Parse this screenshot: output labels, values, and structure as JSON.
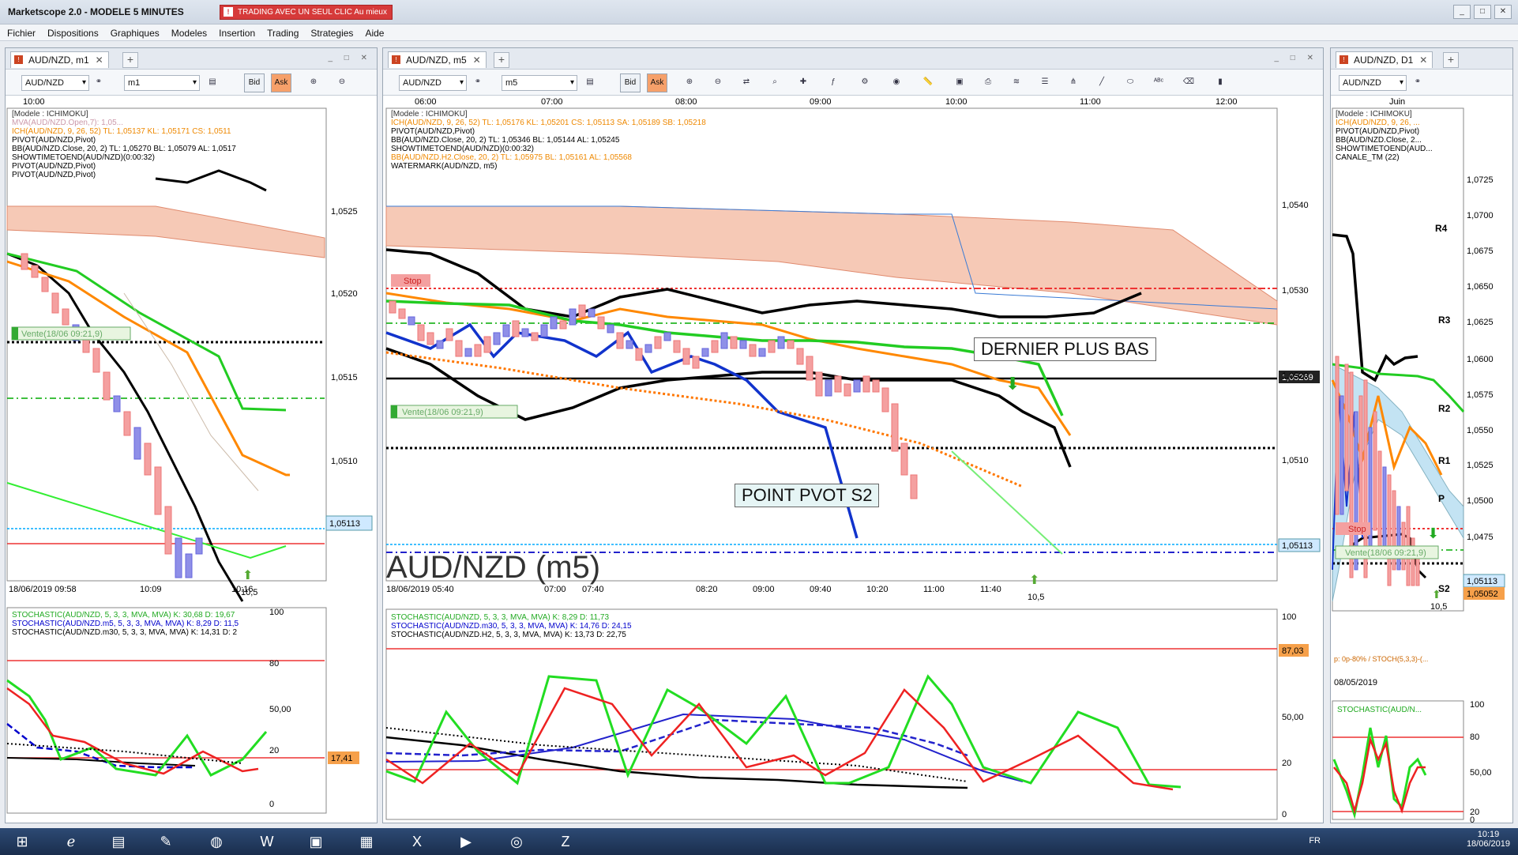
{
  "window": {
    "title": "Marketscope 2.0 - MODELE 5 MINUTES",
    "promo": "TRADING AVEC UN SEUL CLIC Au mieux"
  },
  "menu": [
    "Fichier",
    "Dispositions",
    "Graphiques",
    "Modeles",
    "Insertion",
    "Trading",
    "Strategies",
    "Aide"
  ],
  "left": {
    "tab": "AUD/NZD, m1",
    "instrument": "AUD/NZD",
    "period": "m1",
    "time_top": "10:00",
    "indicators": [
      "[Modele : ICHIMOKU]",
      "MVA(AUD/NZD.Open,7): 1,05...",
      "ICH(AUD/NZD, 9, 26, 52) TL: 1,05137 KL: 1,05171 CS: 1,0511",
      "PIVOT(AUD/NZD,Pivot)",
      "BB(AUD/NZD.Close, 20, 2) TL: 1,05270 BL: 1,05079 AL: 1,0517",
      "SHOWTIMETOEND(AUD/NZD)(0:00:32)",
      "PIVOT(AUD/NZD,Pivot)",
      "PIVOT(AUD/NZD,Pivot)"
    ],
    "y_ticks": [
      "1,0525",
      "1,0520",
      "1,0515",
      "1,0510"
    ],
    "price_tag": "1,05113",
    "order_label": "Vente(18/06 09:21,9)",
    "arrow_label": "10,5",
    "x_ticks": [
      "18/06/2019 09:58",
      "10:09",
      "10:16"
    ],
    "stoch_lines": [
      "STOCHASTIC(AUD/NZD, 5, 3, 3, MVA, MVA) K: 30,68 D: 19,67",
      "STOCHASTIC(AUD/NZD.m5, 5, 3, 3, MVA, MVA) K: 8,29 D: 11,5",
      "STOCHASTIC(AUD/NZD.m30, 5, 3, 3, MVA, MVA) K: 14,31 D: 2"
    ],
    "stoch_ticks": [
      "100",
      "80",
      "50,00",
      "20",
      "0"
    ],
    "stoch_tag": "17,41"
  },
  "center": {
    "tab": "AUD/NZD, m5",
    "instrument": "AUD/NZD",
    "period": "m5",
    "time_top": [
      "06:00",
      "07:00",
      "08:00",
      "09:00",
      "10:00",
      "11:00",
      "12:00"
    ],
    "indicators": [
      "[Modele : ICHIMOKU]",
      "ICH(AUD/NZD, 9, 26, 52) TL: 1,05176 KL: 1,05201 CS: 1,05113 SA: 1,05189 SB: 1,05218",
      "PIVOT(AUD/NZD,Pivot)",
      "BB(AUD/NZD.Close, 20, 2) TL: 1,05346 BL: 1,05144 AL: 1,05245",
      "SHOWTIMETOEND(AUD/NZD)(0:00:32)",
      "BB(AUD/NZD.H2.Close, 20, 2) TL: 1,05975 BL: 1,05161 AL: 1,05568",
      "WATERMARK(AUD/NZD, m5)"
    ],
    "y_ticks": [
      "1,0540",
      "1,0530",
      "1,0520",
      "1,0510"
    ],
    "price_tags": [
      "1,05269",
      "1,05113"
    ],
    "stop_label": "Stop",
    "order_label": "Vente(18/06 09:21,9)",
    "annot1": "DERNIER PLUS BAS",
    "annot2": "POINT PVOT S2",
    "watermark": "AUD/NZD (m5)",
    "arrow_label": "10,5",
    "x_ticks": [
      "18/06/2019 05:40",
      "07:00",
      "07:40",
      "08:20",
      "09:00",
      "09:40",
      "10:20",
      "11:00",
      "11:40"
    ],
    "stoch_lines": [
      "STOCHASTIC(AUD/NZD, 5, 3, 3, MVA, MVA) K: 8,29 D: 11,73",
      "STOCHASTIC(AUD/NZD.m30, 5, 3, 3, MVA, MVA) K: 14,76 D: 24,15",
      "STOCHASTIC(AUD/NZD.H2, 5, 3, 3, MVA, MVA) K: 13,73 D: 22,75"
    ],
    "stoch_ticks": [
      "100",
      "80",
      "50,00",
      "20",
      "0"
    ],
    "stoch_tag": "87,03"
  },
  "right": {
    "tab": "AUD/NZD, D1",
    "instrument": "AUD/NZD",
    "time_top": "Juin",
    "indicators": [
      "[Modele : ICHIMOKU]",
      "ICH(AUD/NZD, 9, 26, ...",
      "PIVOT(AUD/NZD,Pivot)",
      "BB(AUD/NZD.Close, 2...",
      "SHOWTIMETOEND(AUD...",
      "CANALE_TM (22)"
    ],
    "y_ticks": [
      "1,0725",
      "1,0700",
      "1,0675",
      "1,0650",
      "1,0625",
      "1,0600",
      "1,0575",
      "1,0550",
      "1,0525",
      "1,0500",
      "1,0475"
    ],
    "pivots": [
      "R4",
      "R3",
      "R2",
      "R1",
      "P",
      "S2"
    ],
    "price_tags": [
      "1,05113",
      "1,05052"
    ],
    "stop_label": "Stop",
    "order_label": "Vente(18/06 09:21,9)",
    "arrow_label": "10,5",
    "bottom_note": "p: 0p-80% / STOCH(5,3,3)-(...",
    "x_tick": "08/05/2019",
    "stoch_line": "STOCHASTIC(AUD/N...",
    "stoch_ticks": [
      "100",
      "80",
      "50,00",
      "20",
      "0"
    ]
  },
  "taskbar": {
    "lang": "FR",
    "time": "10:19",
    "date": "18/06/2019"
  }
}
